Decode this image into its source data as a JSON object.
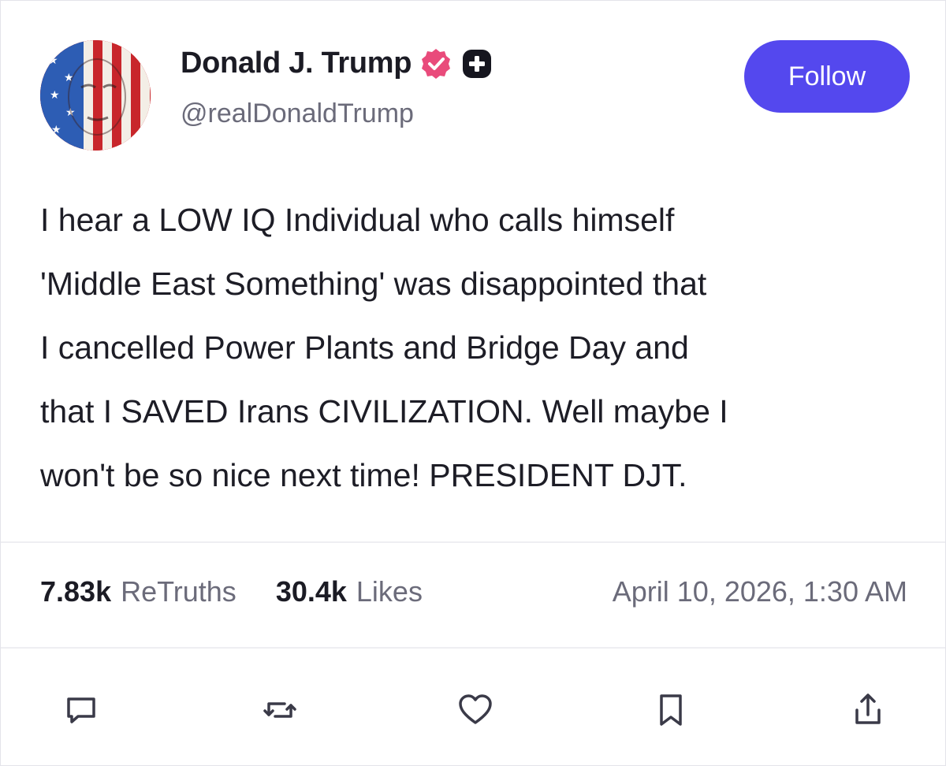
{
  "author": {
    "display_name": "Donald J. Trump",
    "handle": "@realDonaldTrump",
    "avatar_icon": "flag-portrait-avatar",
    "verified_icon": "verified-badge-icon",
    "verified_color": "#e94b7b",
    "plus_badge_icon": "plus-badge-icon"
  },
  "follow_button": {
    "label": "Follow",
    "color": "#5448ee"
  },
  "post": {
    "text": "I hear a LOW IQ Individual who calls himself\n'Middle East Something' was disappointed that\nI cancelled Power Plants and Bridge Day and\nthat I SAVED Irans CIVILIZATION. Well maybe I\nwon't be so nice next time! PRESIDENT DJT."
  },
  "stats": {
    "retruths_count": "7.83k",
    "retruths_label": "ReTruths",
    "likes_count": "30.4k",
    "likes_label": "Likes",
    "timestamp": "April 10, 2026, 1:30 AM"
  },
  "actions": [
    {
      "name": "reply",
      "icon": "comment-icon"
    },
    {
      "name": "retruth",
      "icon": "retruth-icon"
    },
    {
      "name": "like",
      "icon": "heart-icon"
    },
    {
      "name": "bookmark",
      "icon": "bookmark-icon"
    },
    {
      "name": "share",
      "icon": "share-icon"
    }
  ]
}
